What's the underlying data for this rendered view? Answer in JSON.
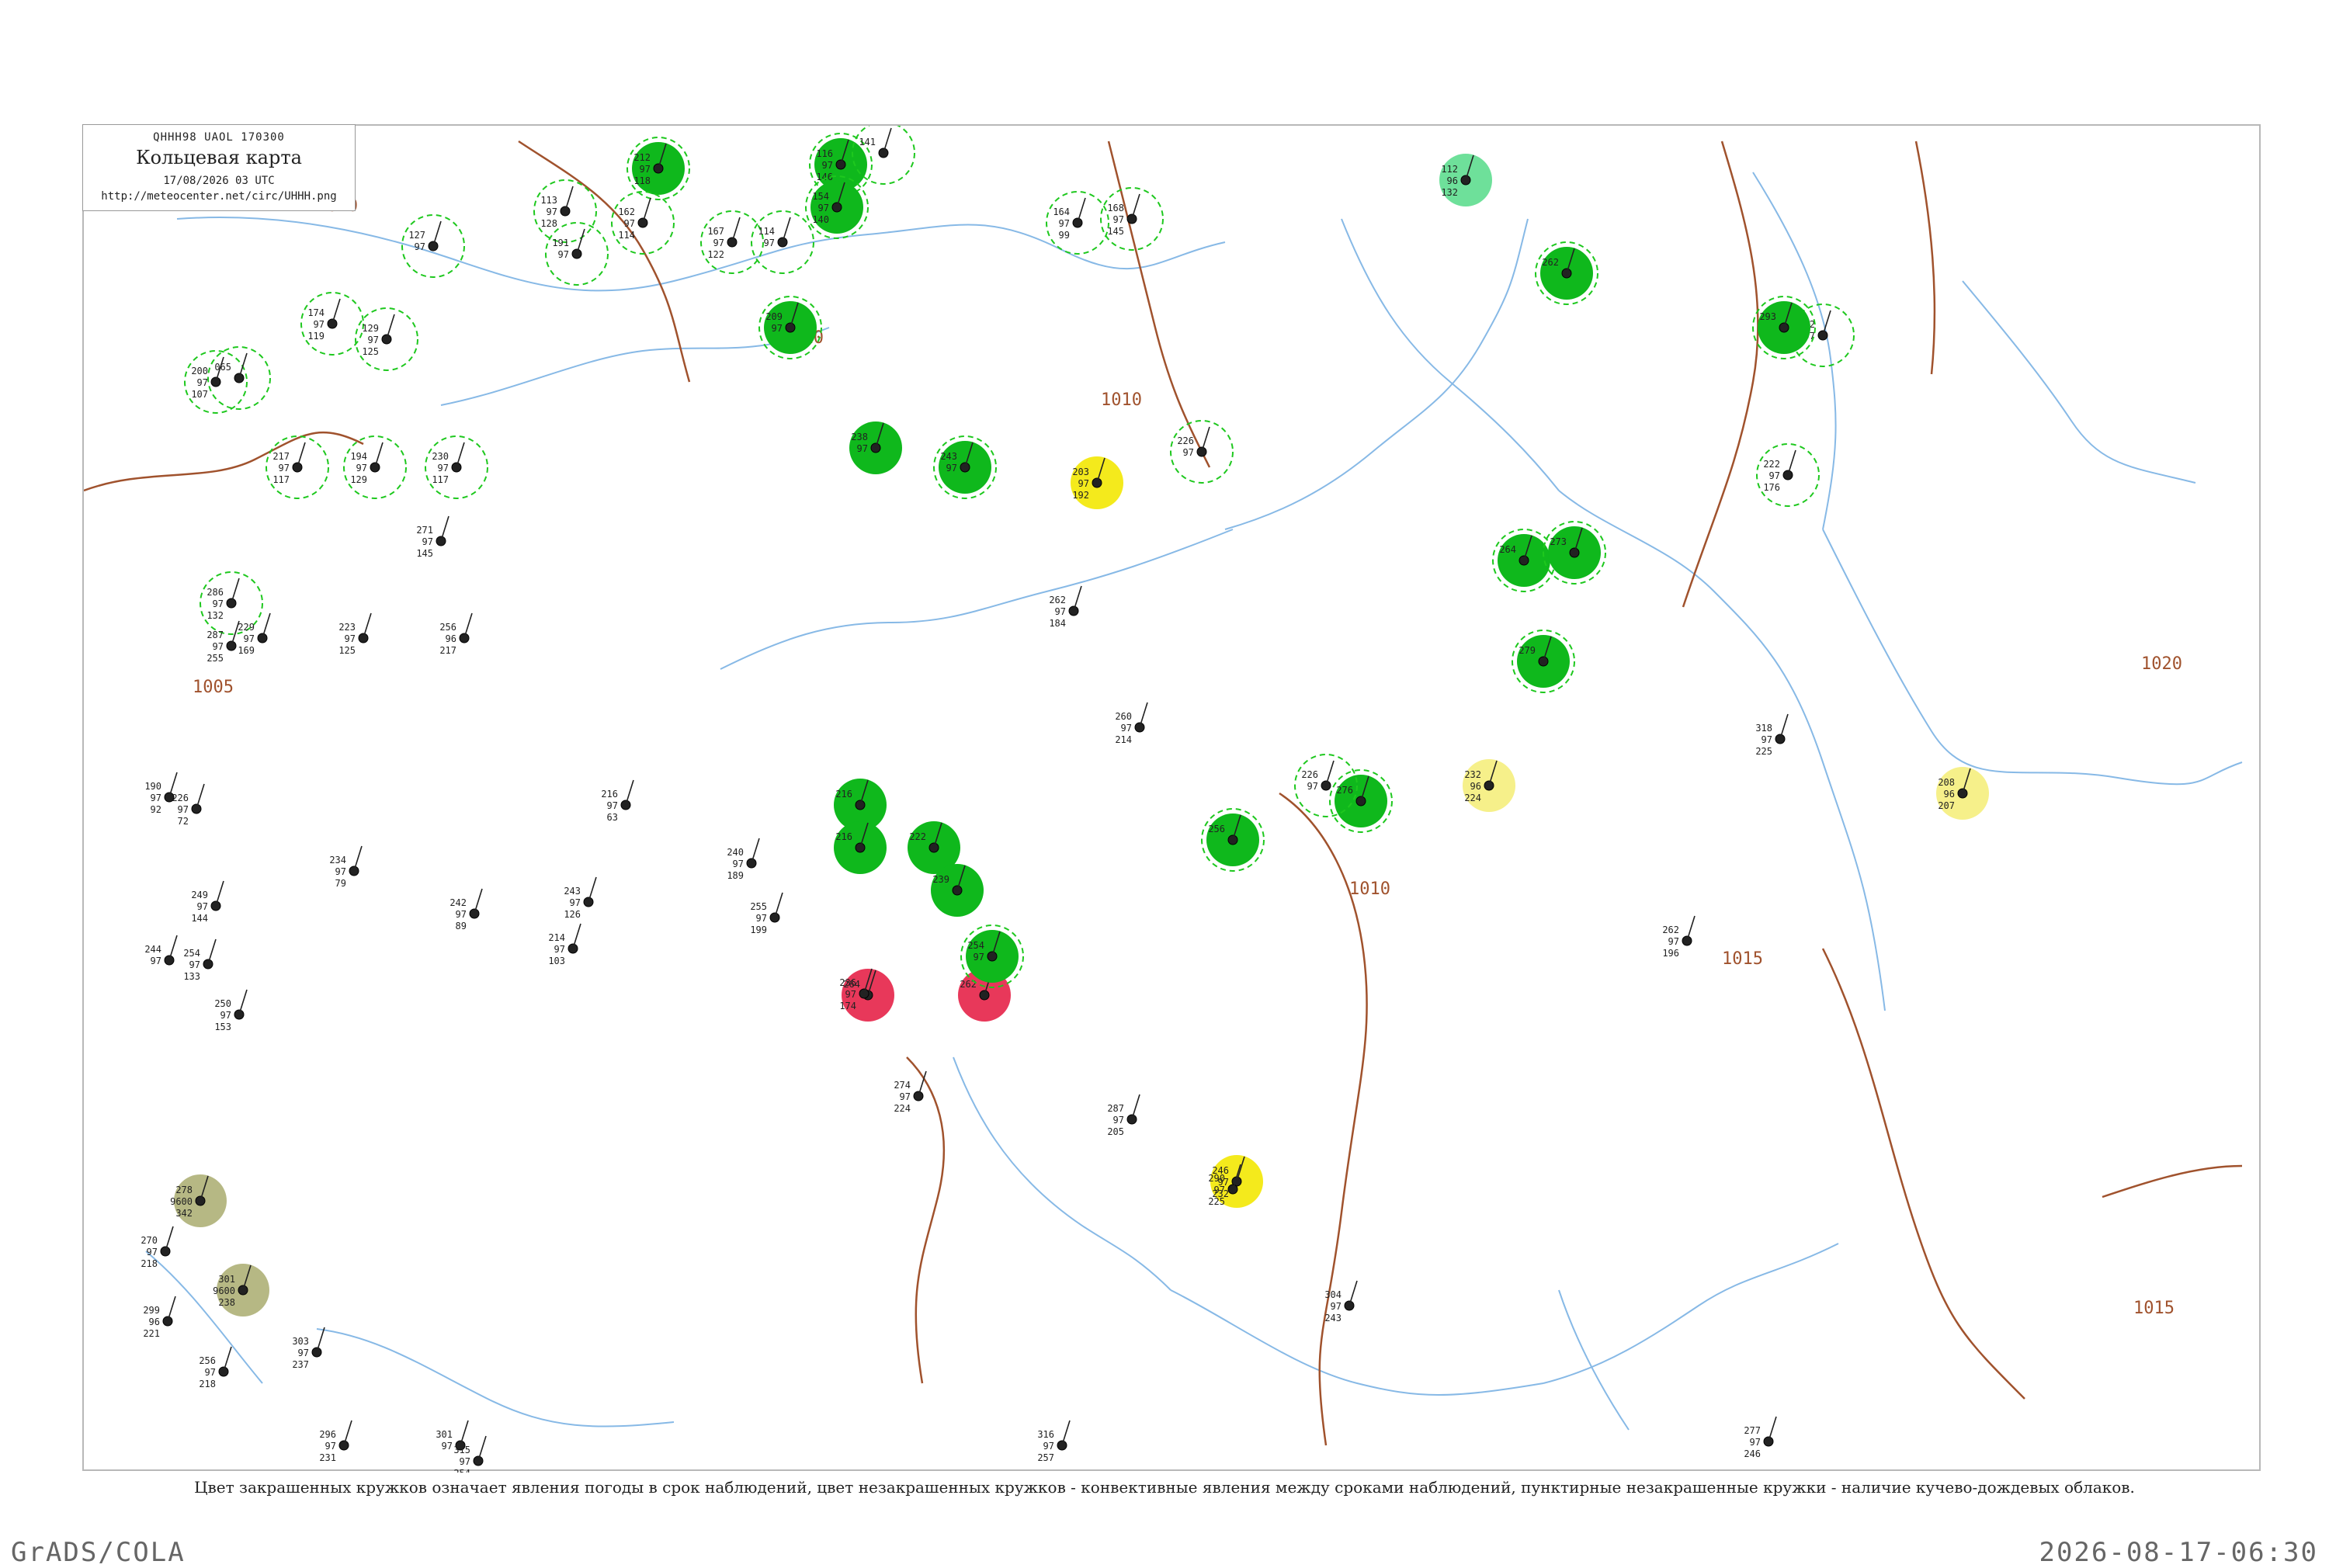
{
  "header": {
    "code": "QHHH98  UAOL  170300",
    "title": "Кольцевая карта",
    "date": "17/08/2026 03 UTC",
    "url": "http://meteocenter.net/circ/UHHH.png"
  },
  "caption": "Цвет закрашенных кружков означает явления погоды в срок наблюдений, цвет незакрашенных кружков - конвективные явления между сроками наблюдений, пунктирные незакрашенные кружки - наличие кучево-дождевых облаков.",
  "footer": {
    "left": "GrADS/COLA",
    "right": "2026-08-17-06:30"
  },
  "colors": {
    "rain": "#0fb81c",
    "storm": "#e8385a",
    "drizzle": "#f4ea1c",
    "light": "#f6f08a",
    "haze": "#b6b884",
    "mist": "#6ee09a",
    "cb_ring": "#1ec81e",
    "isobar": "#a0522d",
    "river": "#87b9e6",
    "station": "#222222"
  },
  "isobar_labels": [
    {
      "id": "1010-nw",
      "text": "1010"
    },
    {
      "id": "1005",
      "text": "1005"
    },
    {
      "id": "1010-c",
      "text": "1010"
    },
    {
      "id": "1010-e",
      "text": "1010"
    },
    {
      "id": "1015-e",
      "text": "1015"
    },
    {
      "id": "1020",
      "text": "1020"
    },
    {
      "id": "1010-s",
      "text": "1010"
    },
    {
      "id": "1015-se",
      "text": "1015"
    }
  ],
  "stations": [
    {
      "p": "113",
      "d": "97",
      "l": "128",
      "fill": "",
      "ring": true
    },
    {
      "p": "212",
      "d": "97",
      "l": "118",
      "fill": "rain",
      "ring": true
    },
    {
      "p": "116",
      "d": "97",
      "l": "146",
      "fill": "rain",
      "ring": true
    },
    {
      "p": "141",
      "d": "",
      "l": "",
      "fill": "",
      "ring": true
    },
    {
      "p": "112",
      "d": "96",
      "l": "132",
      "fill": "mist",
      "ring": false
    },
    {
      "p": "154",
      "d": "97",
      "l": "140",
      "fill": "rain",
      "ring": true
    },
    {
      "p": "162",
      "d": "97",
      "l": "114",
      "fill": "",
      "ring": true
    },
    {
      "p": "167",
      "d": "97",
      "l": "122",
      "fill": "",
      "ring": true
    },
    {
      "p": "114",
      "d": "97",
      "l": "",
      "fill": "",
      "ring": true
    },
    {
      "p": "191",
      "d": "97",
      "l": "",
      "fill": "",
      "ring": true
    },
    {
      "p": "164",
      "d": "97",
      "l": "99",
      "fill": "",
      "ring": true
    },
    {
      "p": "168",
      "d": "97",
      "l": "145",
      "fill": "",
      "ring": true
    },
    {
      "p": "127",
      "d": "97",
      "l": "",
      "fill": "",
      "ring": true
    },
    {
      "p": "174",
      "d": "97",
      "l": "119",
      "fill": "",
      "ring": true
    },
    {
      "p": "200",
      "d": "97",
      "l": "107",
      "fill": "",
      "ring": true
    },
    {
      "p": "065",
      "d": "",
      "l": "",
      "fill": "",
      "ring": true
    },
    {
      "p": "217",
      "d": "97",
      "l": "117",
      "fill": "",
      "ring": true
    },
    {
      "p": "194",
      "d": "97",
      "l": "129",
      "fill": "",
      "ring": true
    },
    {
      "p": "230",
      "d": "97",
      "l": "117",
      "fill": "",
      "ring": true
    },
    {
      "p": "129",
      "d": "97",
      "l": "125",
      "fill": "",
      "ring": true
    },
    {
      "p": "286",
      "d": "97",
      "l": "132",
      "fill": "",
      "ring": true
    },
    {
      "p": "209",
      "d": "97",
      "l": "",
      "fill": "rain",
      "ring": true
    },
    {
      "p": "243",
      "d": "97",
      "l": "",
      "fill": "rain",
      "ring": true
    },
    {
      "p": "238",
      "d": "97",
      "l": "",
      "fill": "rain",
      "ring": false
    },
    {
      "p": "203",
      "d": "97",
      "l": "192",
      "fill": "drizzle",
      "ring": false
    },
    {
      "p": "226",
      "d": "97",
      "l": "",
      "fill": "",
      "ring": true
    },
    {
      "p": "264",
      "d": "",
      "l": "",
      "fill": "rain",
      "ring": true
    },
    {
      "p": "273",
      "d": "",
      "l": "",
      "fill": "rain",
      "ring": true
    },
    {
      "p": "252",
      "d": "97",
      "l": "",
      "fill": "",
      "ring": true
    },
    {
      "p": "262",
      "d": "",
      "l": "",
      "fill": "rain",
      "ring": true
    },
    {
      "p": "293",
      "d": "",
      "l": "",
      "fill": "rain",
      "ring": true
    },
    {
      "p": "232",
      "d": "96",
      "l": "224",
      "fill": "light",
      "ring": false
    },
    {
      "p": "208",
      "d": "96",
      "l": "207",
      "fill": "light",
      "ring": false
    },
    {
      "p": "279",
      "d": "",
      "l": "",
      "fill": "rain",
      "ring": true
    },
    {
      "p": "222",
      "d": "97",
      "l": "176",
      "fill": "",
      "ring": true
    },
    {
      "p": "216",
      "d": "",
      "l": "",
      "fill": "rain",
      "ring": false
    },
    {
      "p": "216",
      "d": "",
      "l": "",
      "fill": "rain",
      "ring": false
    },
    {
      "p": "222",
      "d": "",
      "l": "",
      "fill": "rain",
      "ring": false
    },
    {
      "p": "239",
      "d": "",
      "l": "",
      "fill": "rain",
      "ring": false
    },
    {
      "p": "246",
      "d": "97",
      "l": "232",
      "fill": "drizzle",
      "ring": false
    },
    {
      "p": "278",
      "d": "9600",
      "l": "342",
      "fill": "haze",
      "ring": false
    },
    {
      "p": "301",
      "d": "9600",
      "l": "238",
      "fill": "haze",
      "ring": false
    },
    {
      "p": "264",
      "d": "",
      "l": "",
      "fill": "storm",
      "ring": false
    },
    {
      "p": "262",
      "d": "",
      "l": "",
      "fill": "storm",
      "ring": false
    },
    {
      "p": "254",
      "d": "97",
      "l": "",
      "fill": "rain",
      "ring": true
    },
    {
      "p": "256",
      "d": "",
      "l": "",
      "fill": "rain",
      "ring": true
    },
    {
      "p": "276",
      "d": "",
      "l": "",
      "fill": "rain",
      "ring": true
    },
    {
      "p": "226",
      "d": "97",
      "l": "",
      "fill": "",
      "ring": true
    },
    {
      "p": "240",
      "d": "97",
      "l": "189",
      "fill": "",
      "ring": false
    },
    {
      "p": "255",
      "d": "97",
      "l": "199",
      "fill": "",
      "ring": false
    },
    {
      "p": "274",
      "d": "97",
      "l": "224",
      "fill": "",
      "ring": false
    },
    {
      "p": "262",
      "d": "97",
      "l": "184",
      "fill": "",
      "ring": false
    },
    {
      "p": "260",
      "d": "97",
      "l": "214",
      "fill": "",
      "ring": false
    },
    {
      "p": "287",
      "d": "97",
      "l": "205",
      "fill": "",
      "ring": false
    },
    {
      "p": "290",
      "d": "97",
      "l": "225",
      "fill": "",
      "ring": false
    },
    {
      "p": "304",
      "d": "97",
      "l": "243",
      "fill": "",
      "ring": false
    },
    {
      "p": "318",
      "d": "97",
      "l": "225",
      "fill": "",
      "ring": false
    },
    {
      "p": "262",
      "d": "97",
      "l": "196",
      "fill": "",
      "ring": false
    },
    {
      "p": "270",
      "d": "97",
      "l": "218",
      "fill": "",
      "ring": false
    },
    {
      "p": "299",
      "d": "96",
      "l": "221",
      "fill": "",
      "ring": false
    },
    {
      "p": "256",
      "d": "97",
      "l": "218",
      "fill": "",
      "ring": false
    },
    {
      "p": "303",
      "d": "97",
      "l": "237",
      "fill": "",
      "ring": false
    },
    {
      "p": "296",
      "d": "97",
      "l": "231",
      "fill": "",
      "ring": false
    },
    {
      "p": "301",
      "d": "97",
      "l": "",
      "fill": "",
      "ring": false
    },
    {
      "p": "315",
      "d": "97",
      "l": "254",
      "fill": "",
      "ring": false
    },
    {
      "p": "316",
      "d": "97",
      "l": "257",
      "fill": "",
      "ring": false
    },
    {
      "p": "277",
      "d": "97",
      "l": "246",
      "fill": "",
      "ring": false
    },
    {
      "p": "287",
      "d": "97",
      "l": "255",
      "fill": "",
      "ring": false
    },
    {
      "p": "190",
      "d": "97",
      "l": "92",
      "fill": "",
      "ring": false
    },
    {
      "p": "226",
      "d": "97",
      "l": "72",
      "fill": "",
      "ring": false
    },
    {
      "p": "244",
      "d": "97",
      "l": "",
      "fill": "",
      "ring": false
    },
    {
      "p": "254",
      "d": "97",
      "l": "133",
      "fill": "",
      "ring": false
    },
    {
      "p": "250",
      "d": "97",
      "l": "153",
      "fill": "",
      "ring": false
    },
    {
      "p": "249",
      "d": "97",
      "l": "144",
      "fill": "",
      "ring": false
    },
    {
      "p": "234",
      "d": "97",
      "l": "79",
      "fill": "",
      "ring": false
    },
    {
      "p": "216",
      "d": "97",
      "l": "63",
      "fill": "",
      "ring": false
    },
    {
      "p": "242",
      "d": "97",
      "l": "89",
      "fill": "",
      "ring": false
    },
    {
      "p": "214",
      "d": "97",
      "l": "103",
      "fill": "",
      "ring": false
    },
    {
      "p": "243",
      "d": "97",
      "l": "126",
      "fill": "",
      "ring": false
    },
    {
      "p": "271",
      "d": "97",
      "l": "145",
      "fill": "",
      "ring": false
    },
    {
      "p": "236",
      "d": "97",
      "l": "174",
      "fill": "",
      "ring": false
    },
    {
      "p": "229",
      "d": "97",
      "l": "169",
      "fill": "",
      "ring": false
    },
    {
      "p": "223",
      "d": "97",
      "l": "125",
      "fill": "",
      "ring": false
    },
    {
      "p": "256",
      "d": "96",
      "l": "217",
      "fill": "",
      "ring": false
    }
  ]
}
